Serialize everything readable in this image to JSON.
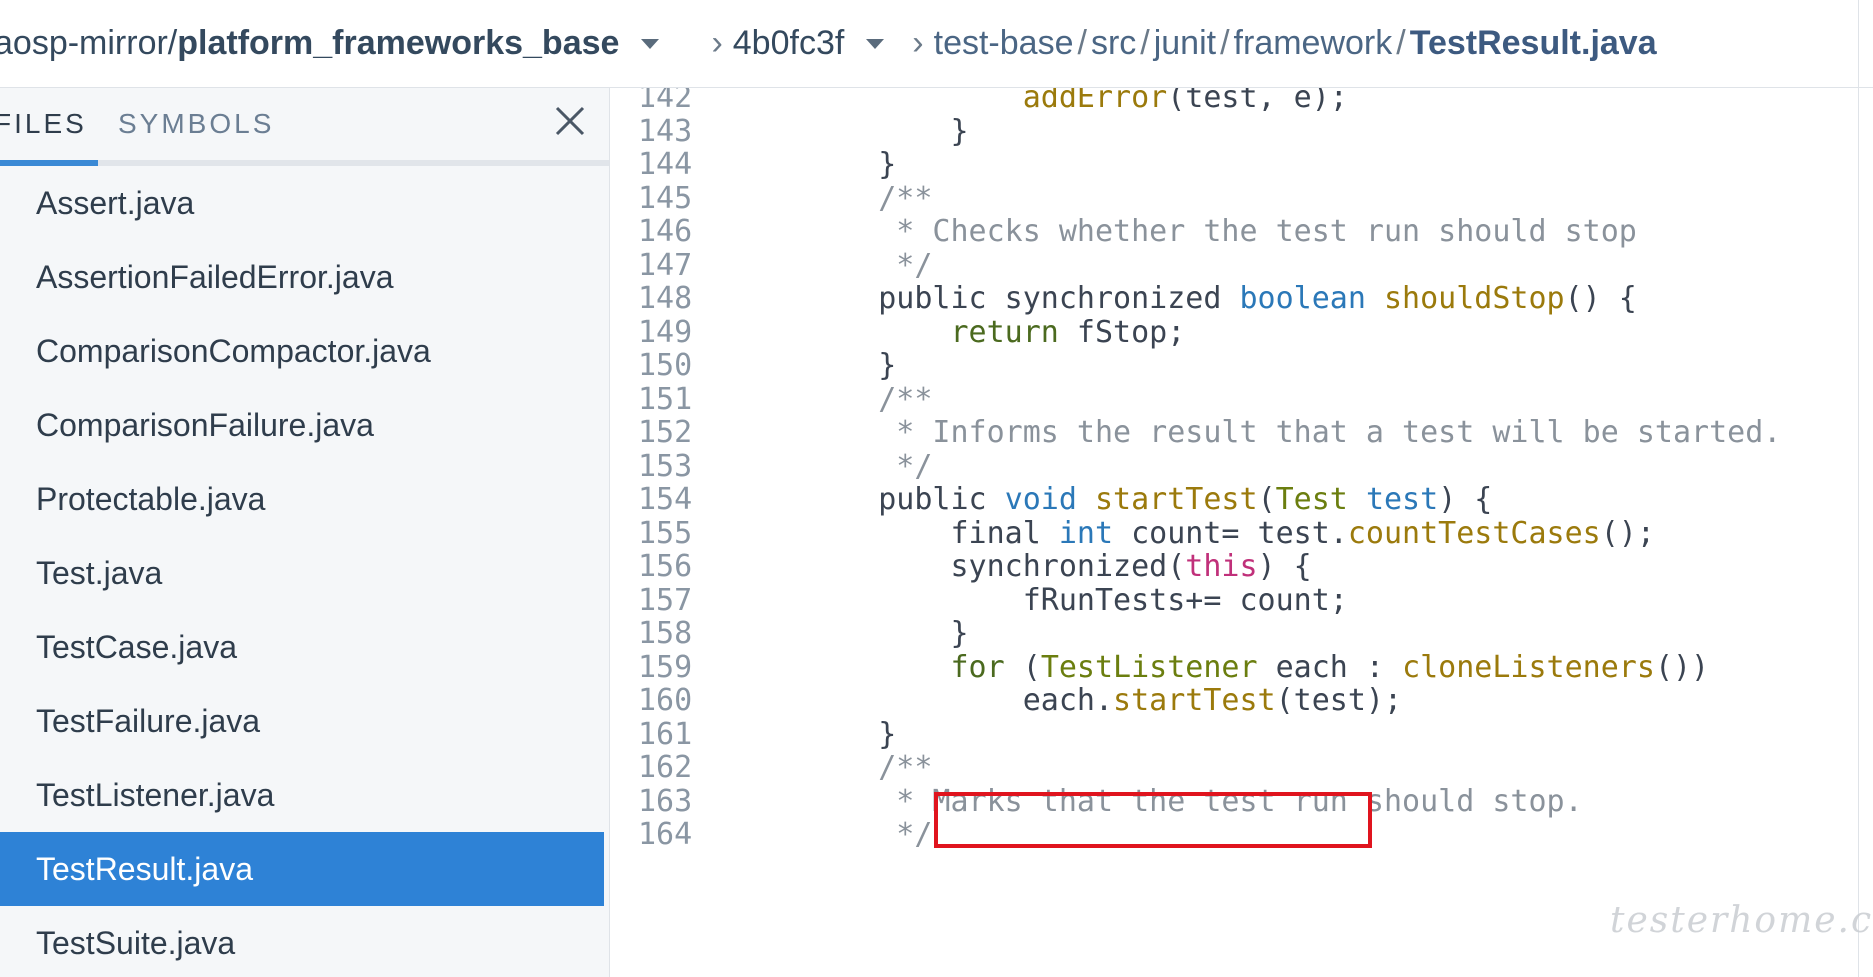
{
  "header": {
    "repo_owner": "aosp-mirror/",
    "repo_name": "platform_frameworks_base",
    "revision": "4b0fc3f",
    "path": [
      "test-base",
      "src",
      "junit",
      "framework"
    ],
    "file": "TestResult.java"
  },
  "sidebar": {
    "tabs": [
      {
        "label": "FILES",
        "active": true
      },
      {
        "label": "SYMBOLS",
        "active": false
      }
    ],
    "files": [
      {
        "name": "Assert.java",
        "active": false
      },
      {
        "name": "AssertionFailedError.java",
        "active": false
      },
      {
        "name": "ComparisonCompactor.java",
        "active": false
      },
      {
        "name": "ComparisonFailure.java",
        "active": false
      },
      {
        "name": "Protectable.java",
        "active": false
      },
      {
        "name": "Test.java",
        "active": false
      },
      {
        "name": "TestCase.java",
        "active": false
      },
      {
        "name": "TestFailure.java",
        "active": false
      },
      {
        "name": "TestListener.java",
        "active": false
      },
      {
        "name": "TestResult.java",
        "active": true
      },
      {
        "name": "TestSuite.java",
        "active": false
      }
    ]
  },
  "code": {
    "lines": [
      {
        "n": "142",
        "tokens": [
          [
            "",
            "            "
          ],
          [
            "fn",
            "addError"
          ],
          [
            "",
            "(test, e);"
          ]
        ]
      },
      {
        "n": "143",
        "tokens": [
          [
            "",
            "        }"
          ]
        ]
      },
      {
        "n": "144",
        "tokens": [
          [
            "",
            "    }"
          ]
        ]
      },
      {
        "n": "145",
        "tokens": [
          [
            "cm",
            "    /**"
          ]
        ]
      },
      {
        "n": "146",
        "tokens": [
          [
            "cm",
            "     * Checks whether the test run should stop"
          ]
        ]
      },
      {
        "n": "147",
        "tokens": [
          [
            "cm",
            "     */"
          ]
        ]
      },
      {
        "n": "148",
        "tokens": [
          [
            "",
            "    public synchronized "
          ],
          [
            "ty",
            "boolean"
          ],
          [
            "",
            " "
          ],
          [
            "fn",
            "shouldStop"
          ],
          [
            "",
            "() {"
          ]
        ]
      },
      {
        "n": "149",
        "tokens": [
          [
            "",
            "        "
          ],
          [
            "kw",
            "return"
          ],
          [
            "",
            " fStop;"
          ]
        ]
      },
      {
        "n": "150",
        "tokens": [
          [
            "",
            "    }"
          ]
        ]
      },
      {
        "n": "151",
        "tokens": [
          [
            "cm",
            "    /**"
          ]
        ]
      },
      {
        "n": "152",
        "tokens": [
          [
            "cm",
            "     * Informs the result that a test will be started."
          ]
        ]
      },
      {
        "n": "153",
        "tokens": [
          [
            "cm",
            "     */"
          ]
        ]
      },
      {
        "n": "154",
        "tokens": [
          [
            "",
            "    public "
          ],
          [
            "ty",
            "void"
          ],
          [
            "",
            " "
          ],
          [
            "fn",
            "startTest"
          ],
          [
            "",
            "("
          ],
          [
            "tc",
            "Test"
          ],
          [
            "",
            " "
          ],
          [
            "ty",
            "test"
          ],
          [
            "",
            ") {"
          ]
        ]
      },
      {
        "n": "155",
        "tokens": [
          [
            "",
            "        final "
          ],
          [
            "ty",
            "int"
          ],
          [
            "",
            " count= test."
          ],
          [
            "fn",
            "countTestCases"
          ],
          [
            "",
            "();"
          ]
        ]
      },
      {
        "n": "156",
        "tokens": [
          [
            "",
            "        synchronized("
          ],
          [
            "pk",
            "this"
          ],
          [
            "",
            ") {"
          ]
        ]
      },
      {
        "n": "157",
        "tokens": [
          [
            "",
            "            fRunTests+= count;"
          ]
        ]
      },
      {
        "n": "158",
        "tokens": [
          [
            "",
            "        }"
          ]
        ]
      },
      {
        "n": "159",
        "tokens": [
          [
            "",
            "        "
          ],
          [
            "kw",
            "for"
          ],
          [
            "",
            " ("
          ],
          [
            "tc",
            "TestListener"
          ],
          [
            "",
            " each : "
          ],
          [
            "fn",
            "cloneListeners"
          ],
          [
            "",
            "())"
          ]
        ]
      },
      {
        "n": "160",
        "tokens": [
          [
            "",
            "            each."
          ],
          [
            "fn",
            "startTest"
          ],
          [
            "",
            "(test);"
          ]
        ]
      },
      {
        "n": "161",
        "tokens": [
          [
            "",
            "    }"
          ]
        ]
      },
      {
        "n": "162",
        "tokens": [
          [
            "cm",
            "    /**"
          ]
        ]
      },
      {
        "n": "163",
        "tokens": [
          [
            "cm",
            "     * Marks that the test run should stop."
          ]
        ]
      },
      {
        "n": "164",
        "tokens": [
          [
            "cm",
            "     */"
          ]
        ]
      }
    ]
  },
  "watermark": "testerhome.com",
  "colors": {
    "accent": "#2e82d6",
    "highlight_box": "#e0141e"
  }
}
